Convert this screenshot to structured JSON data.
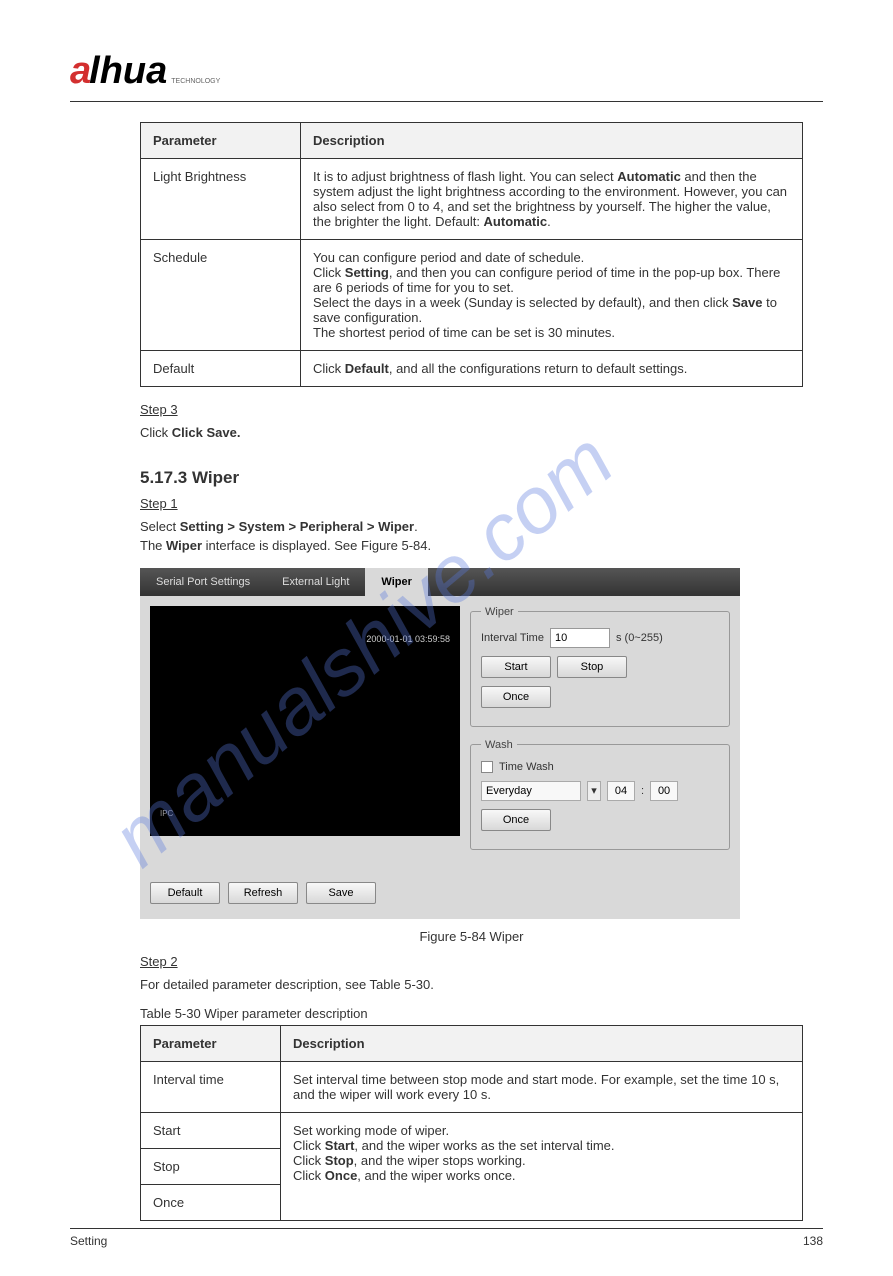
{
  "logo": {
    "part1": "a",
    "part2": "lhua",
    "sub": "TECHNOLOGY"
  },
  "watermark": "manualshive.com",
  "table1": {
    "headers": [
      "Parameter",
      "Description"
    ],
    "rows": [
      {
        "param": "Light Brightness",
        "desc": "It is to adjust brightness of flash light. You can select Automatic and then the system adjust the light brightness according to the environment. However, you can also select from 0 to 4, and set the brightness by yourself. The higher the value, the brighter the light. Default: Automatic."
      },
      {
        "param": "Schedule",
        "desc": "You can configure period and date of schedule.\nClick Setting, and then you can configure period of time in the pop-up box. There are 6 periods of time for you to set.\nSelect the days in a week (Sunday is selected by default), and then click Save to save configuration.\nThe shortest period of time can be set is 30 minutes."
      },
      {
        "param": "Default",
        "desc": "Click Default, and all the configurations return to default settings."
      }
    ]
  },
  "step3_u": "Step 3",
  "step3_text": "Click Save.",
  "section": {
    "title": "5.17.3 Wiper",
    "step1_u": "Step 1",
    "step1_text_1": "Select",
    "step1_path": "Setting > System > Peripheral > Wiper",
    "step1_text_2": ".",
    "step1_text_3": "The",
    "step1_bold": "Wiper",
    "step1_text_4": " interface is displayed. See Figure 5-84."
  },
  "figure": {
    "tabs": [
      "Serial Port Settings",
      "External Light",
      "Wiper"
    ],
    "timestamp": "2000-01-01 03:59:58",
    "ipc": "IPC",
    "wiper_legend": "Wiper",
    "wiper_interval_label": "Interval Time",
    "wiper_interval_value": "10",
    "wiper_interval_suffix": "s (0~255)",
    "btn_start": "Start",
    "btn_stop": "Stop",
    "btn_once": "Once",
    "wash_legend": "Wash",
    "wash_timewash": "Time Wash",
    "wash_everyday": "Everyday",
    "wash_time_h": "04",
    "wash_time_m": "00",
    "wash_once": "Once",
    "btn_default": "Default",
    "btn_refresh": "Refresh",
    "btn_save": "Save",
    "caption": "Figure 5-84 Wiper"
  },
  "step2_u": "Step 2",
  "step2_text": "For detailed parameter description, see Table 5-30.",
  "table2_caption": "Table 5-30 Wiper parameter description",
  "table2": {
    "headers": [
      "Parameter",
      "Description"
    ],
    "rows": [
      {
        "param": "Interval time",
        "desc": "Set interval time between stop mode and start mode. For example, set the time 10 s, and the wiper will work every 10 s."
      },
      {
        "param": "Start",
        "desc_merge": true
      },
      {
        "param": "Stop",
        "desc_merge": true
      },
      {
        "param": "Once",
        "desc_merge": true
      }
    ],
    "merged_desc": "Set working mode of wiper.\nClick Start, and the wiper works as the set interval time.\nClick Stop, and the wiper stops working.\nClick Once, and the wiper works once."
  },
  "footer": {
    "left": "Setting",
    "right": "138"
  }
}
